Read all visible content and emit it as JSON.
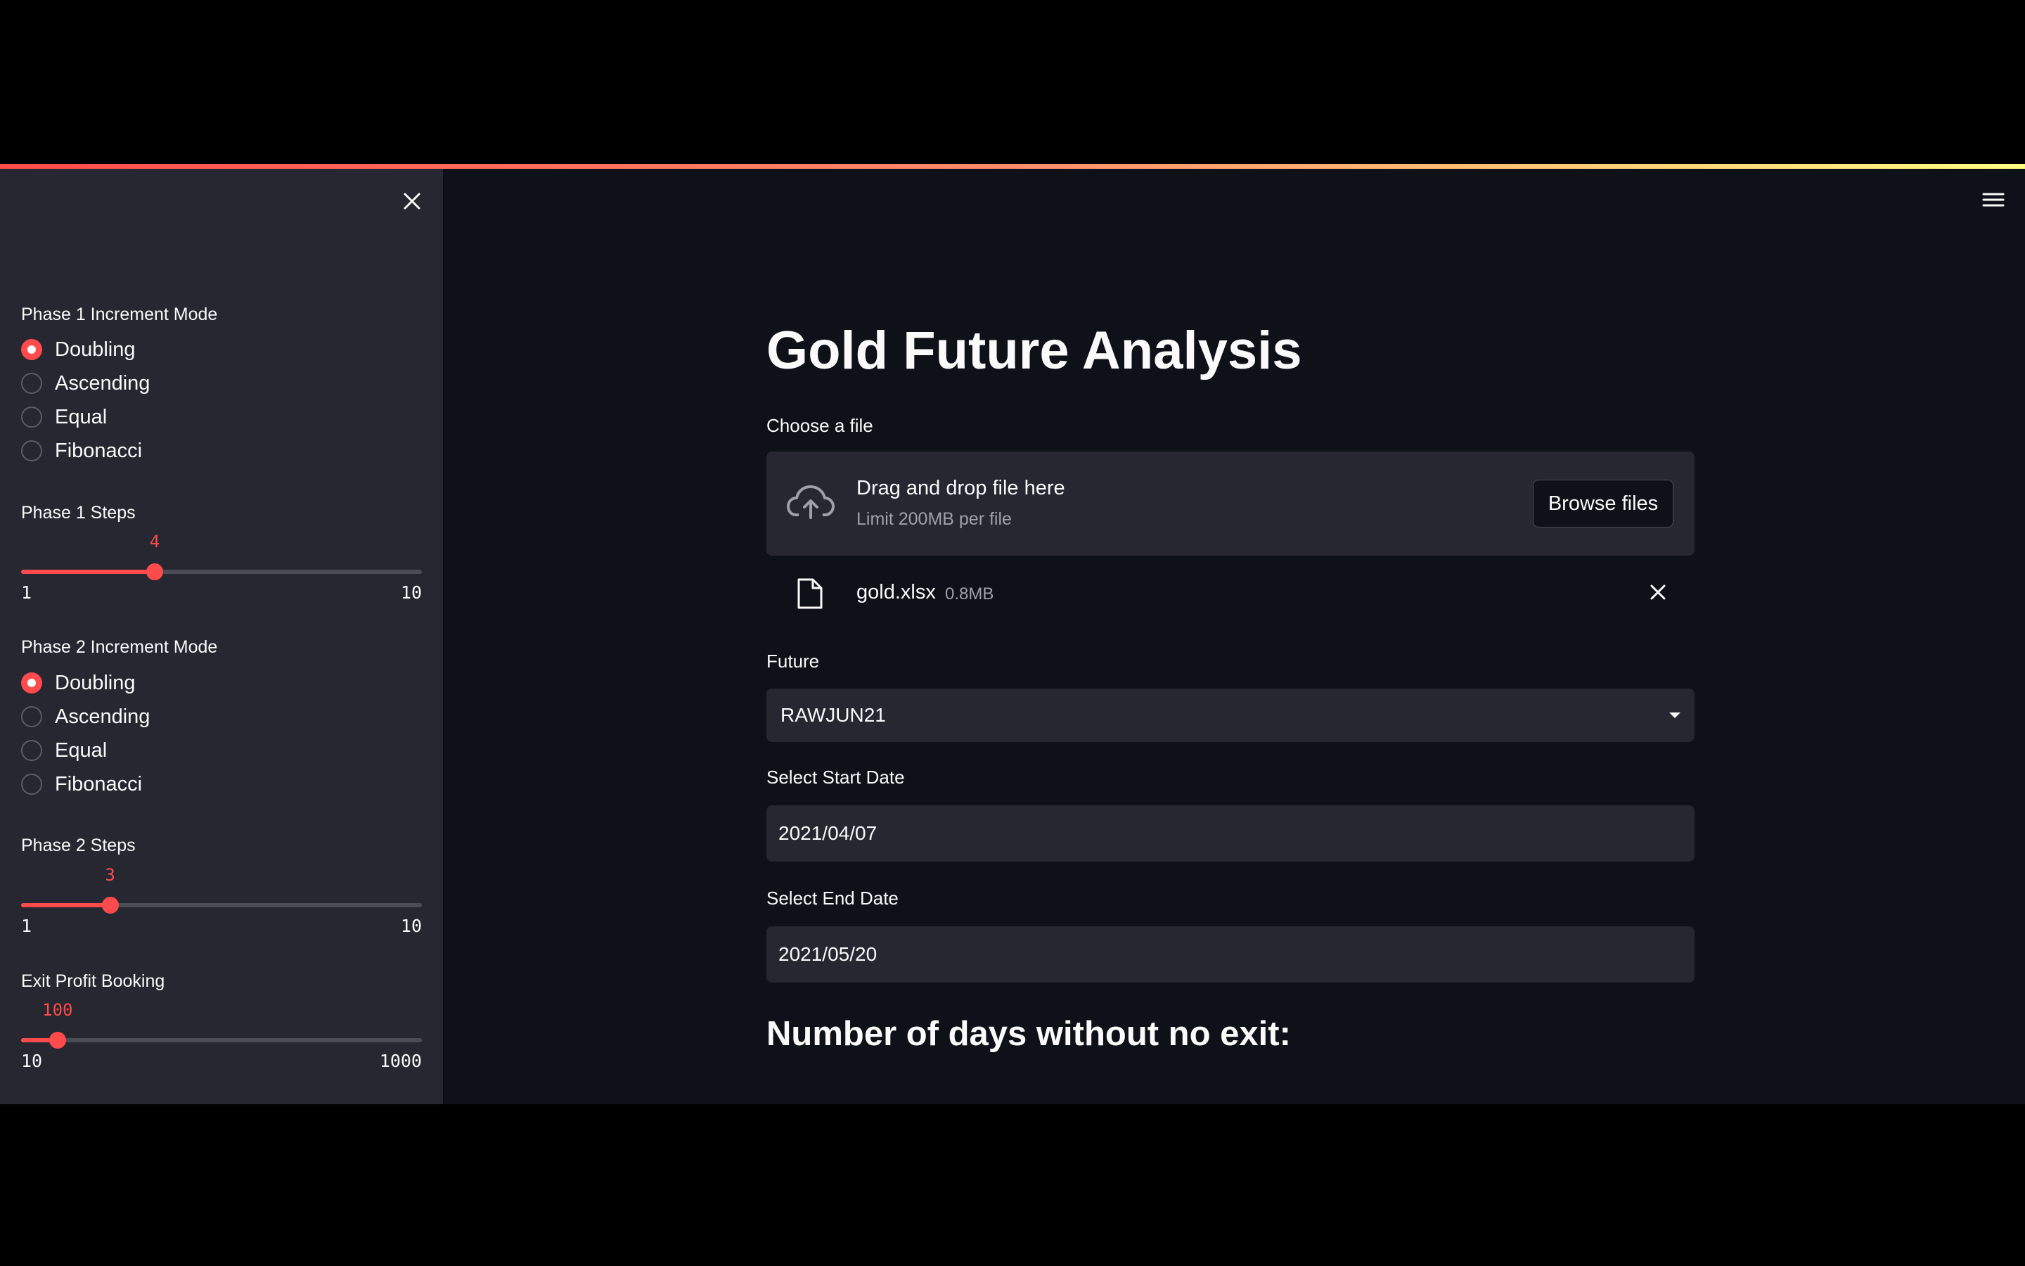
{
  "sidebar": {
    "phase1_mode": {
      "label": "Phase 1 Increment Mode",
      "options": [
        "Doubling",
        "Ascending",
        "Equal",
        "Fibonacci"
      ],
      "selected": "Doubling"
    },
    "phase1_steps": {
      "label": "Phase 1 Steps",
      "value": "4",
      "min": "1",
      "max": "10"
    },
    "phase2_mode": {
      "label": "Phase 2 Increment Mode",
      "options": [
        "Doubling",
        "Ascending",
        "Equal",
        "Fibonacci"
      ],
      "selected": "Doubling"
    },
    "phase2_steps": {
      "label": "Phase 2 Steps",
      "value": "3",
      "min": "1",
      "max": "10"
    },
    "exit_profit": {
      "label": "Exit Profit Booking",
      "value": "100",
      "min": "10",
      "max": "1000"
    }
  },
  "main": {
    "title": "Gold Future Analysis",
    "uploader": {
      "label": "Choose a file",
      "drop_text": "Drag and drop file here",
      "limit_text": "Limit 200MB per file",
      "browse_label": "Browse files",
      "file_name": "gold.xlsx",
      "file_size": "0.8MB"
    },
    "future": {
      "label": "Future",
      "value": "RAWJUN21"
    },
    "start_date": {
      "label": "Select Start Date",
      "value": "2021/04/07"
    },
    "end_date": {
      "label": "Select End Date",
      "value": "2021/05/20"
    },
    "days_heading": "Number of days without no exit:"
  },
  "icons": {
    "close": "close-icon",
    "menu": "hamburger-menu-icon",
    "upload": "cloud-upload-icon",
    "file": "file-icon",
    "remove": "close-icon"
  },
  "colors": {
    "accent": "#ff4b4b",
    "background": "#0e1117",
    "sidebar": "#262730",
    "text": "#fafafa",
    "muted": "#9ea1a9"
  }
}
